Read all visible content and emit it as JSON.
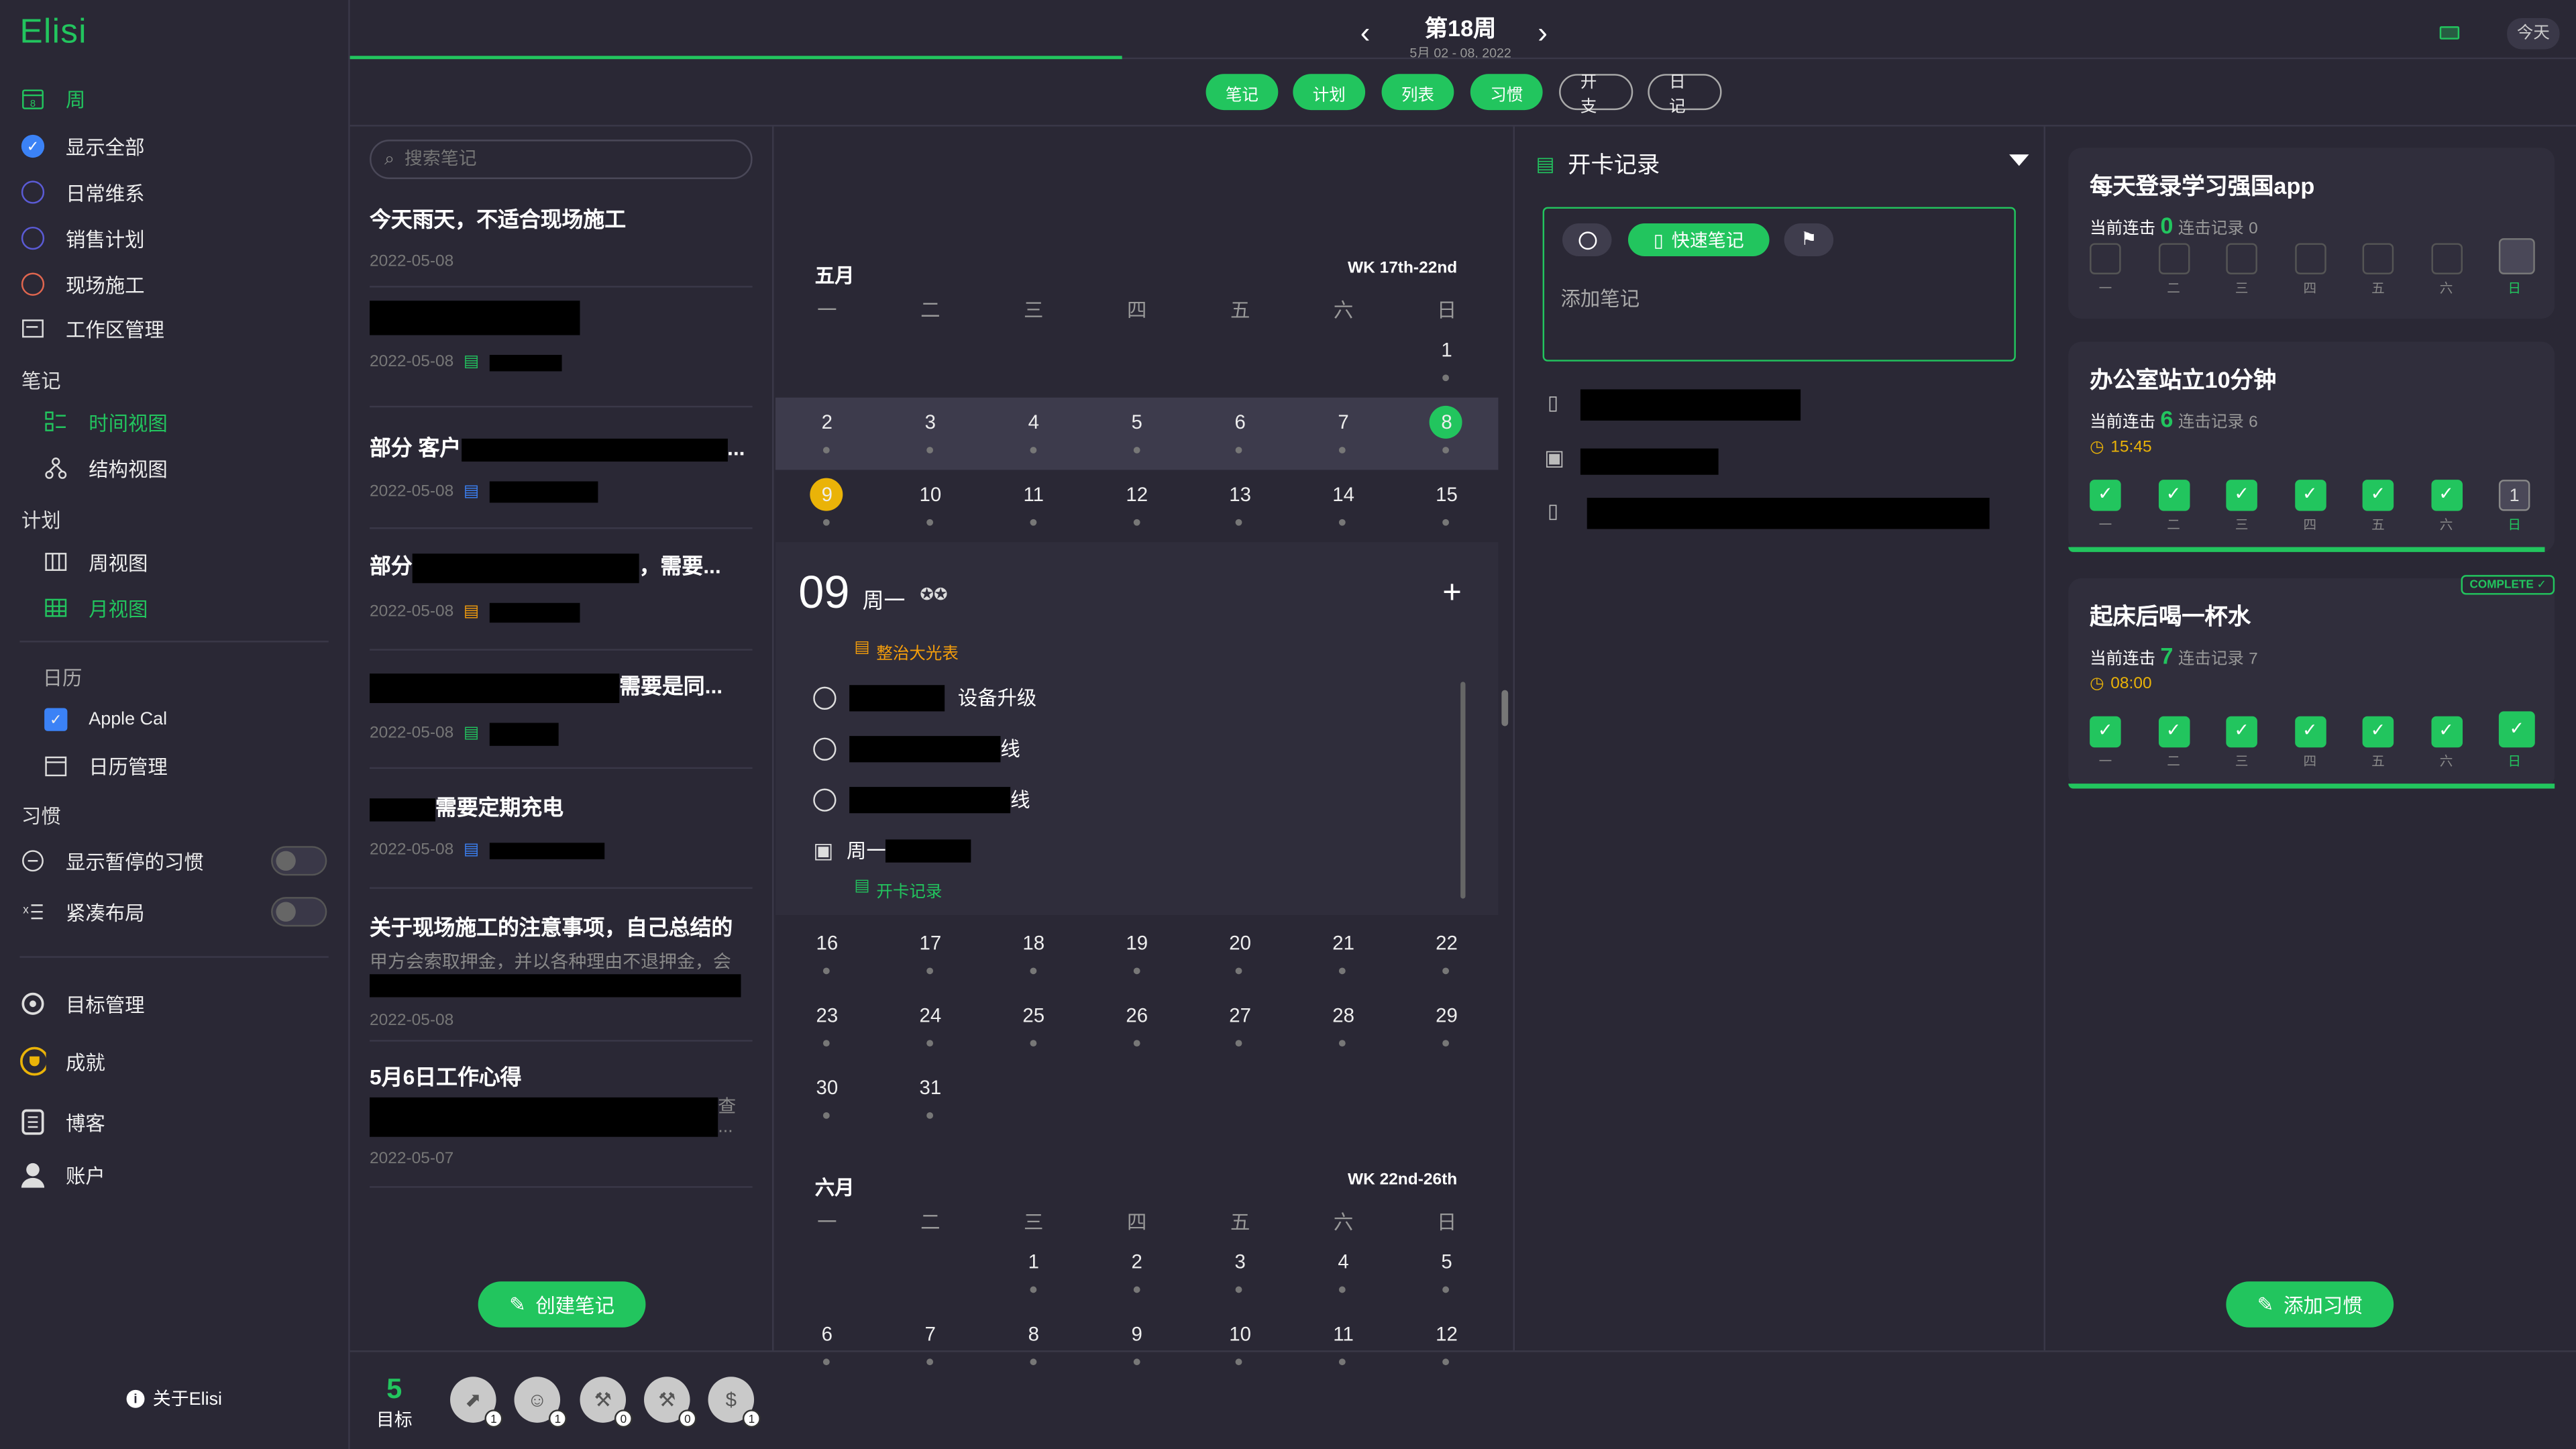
{
  "app": {
    "logo": "Elisi"
  },
  "header": {
    "week_title": "第18周",
    "week_range": "5月 02 - 08, 2022",
    "today_label": "今天"
  },
  "tabs": [
    {
      "label": "笔记",
      "active": true
    },
    {
      "label": "计划",
      "active": true
    },
    {
      "label": "列表",
      "active": true
    },
    {
      "label": "习惯",
      "active": true
    },
    {
      "label": "开支",
      "active": false
    },
    {
      "label": "日记",
      "active": false
    }
  ],
  "sidebar": {
    "week": "周",
    "filters": [
      {
        "label": "显示全部",
        "color": "#3b82f6",
        "checked": true
      },
      {
        "label": "日常维系",
        "color": "#5b5bd6"
      },
      {
        "label": "销售计划",
        "color": "#5b5bd6"
      },
      {
        "label": "现场施工",
        "color": "#e0664f"
      }
    ],
    "workspace": "工作区管理",
    "notes_section": "笔记",
    "time_view": "时间视图",
    "struct_view": "结构视图",
    "plan_section": "计划",
    "week_view": "周视图",
    "month_view": "月视图",
    "calendar_section": "日历",
    "apple_cal": "Apple Cal",
    "cal_manage": "日历管理",
    "habit_section": "习惯",
    "show_paused": "显示暂停的习惯",
    "compact": "紧凑布局",
    "goals": "目标管理",
    "achieve": "成就",
    "blog": "博客",
    "account": "账户",
    "about": "关于Elisi"
  },
  "notes": {
    "search_placeholder": "搜索笔记",
    "items": [
      {
        "title": "今天雨天，不适合现场施工",
        "date": "2022-05-08"
      },
      {
        "title": "",
        "date": "2022-05-08"
      },
      {
        "title": "部分 客户",
        "title_tail": "...",
        "date": "2022-05-08"
      },
      {
        "title": "部分",
        "title_tail": "，需要...",
        "date": "2022-05-08"
      },
      {
        "title": "",
        "title_tail": "需要是同...",
        "date": "2022-05-08"
      },
      {
        "title": "需要定期充电",
        "date": "2022-05-08"
      },
      {
        "title": "关于现场施工的注意事项，自己总结的",
        "preview": "甲方会索取押金，并以各种理由不退押金，会",
        "date": "2022-05-08"
      },
      {
        "title": "5月6日工作心得",
        "preview_tail": "查",
        "preview_tail2": "...",
        "date": "2022-05-07"
      }
    ],
    "create": "创建笔记"
  },
  "calendar": {
    "may": "五月",
    "may_wk": "WK 17th-22nd",
    "june": "六月",
    "june_wk": "WK 22nd-26th",
    "dow": [
      "一",
      "二",
      "三",
      "四",
      "五",
      "六",
      "日"
    ],
    "may_rows": [
      [
        "",
        "",
        "",
        "",
        "",
        "",
        "1"
      ],
      [
        "2",
        "3",
        "4",
        "5",
        "6",
        "7",
        "8"
      ],
      [
        "9",
        "10",
        "11",
        "12",
        "13",
        "14",
        "15"
      ],
      [
        "16",
        "17",
        "18",
        "19",
        "20",
        "21",
        "22"
      ],
      [
        "23",
        "24",
        "25",
        "26",
        "27",
        "28",
        "29"
      ],
      [
        "30",
        "31",
        "",
        "",
        "",
        "",
        ""
      ]
    ],
    "june_rows": [
      [
        "",
        "",
        "1",
        "2",
        "3",
        "4",
        "5"
      ],
      [
        "6",
        "7",
        "8",
        "9",
        "10",
        "11",
        "12"
      ]
    ],
    "day_num": "09",
    "day_name": "周一",
    "tag1": "整治大光表",
    "task1": "设备升级",
    "task2": "线",
    "task3": "线",
    "task4": "周一",
    "tag2": "开卡记录"
  },
  "detail": {
    "title": "开卡记录",
    "quick": "快速笔记",
    "add_note": "添加笔记"
  },
  "habits": {
    "days": [
      "一",
      "二",
      "三",
      "四",
      "五",
      "六",
      "日"
    ],
    "streak_label": "当前连击",
    "record_label": "连击记录",
    "items": [
      {
        "title": "每天登录学习强国app",
        "streak": "0",
        "record": "0",
        "time": "",
        "checks": [
          0,
          0,
          0,
          0,
          0,
          0,
          0
        ]
      },
      {
        "title": "办公室站立10分钟",
        "streak": "6",
        "record": "6",
        "time": "15:45",
        "checks": [
          1,
          1,
          1,
          1,
          1,
          1,
          0
        ]
      },
      {
        "title": "起床后喝一杯水",
        "streak": "7",
        "record": "7",
        "time": "08:00",
        "checks": [
          1,
          1,
          1,
          1,
          1,
          1,
          1
        ],
        "complete": "COMPLETE"
      }
    ],
    "today_count": "1",
    "add": "添加习惯"
  },
  "goals": {
    "count": "5",
    "label": "目标",
    "badges": [
      "1",
      "1",
      "0",
      "0",
      "1"
    ]
  }
}
